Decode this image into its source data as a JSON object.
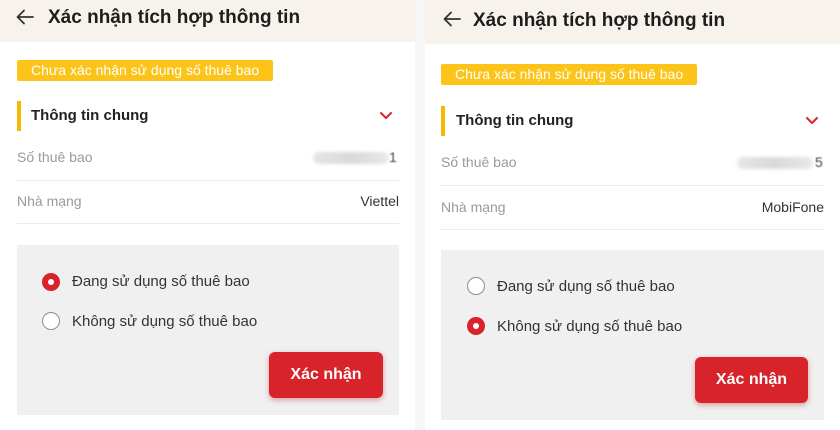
{
  "colors": {
    "accent": "#d8232a",
    "badge": "#fcc419",
    "section_bar": "#f5b800",
    "header_bg": "#f7f3ec",
    "option_box_bg": "#f0f0f0"
  },
  "icons": {
    "back": "arrow-left-icon",
    "expand": "chevron-down-icon"
  },
  "screens": [
    {
      "header": {
        "title": "Xác nhận tích hợp thông tin"
      },
      "status_badge": "Chưa xác nhận sử dụng số thuê bao",
      "section": {
        "title": "Thông tin chung",
        "expanded": true
      },
      "fields": [
        {
          "label": "Số thuê bao",
          "value_suffix": "1",
          "value_redacted": true
        },
        {
          "label": "Nhà mạng",
          "value": "Viettel"
        }
      ],
      "options": [
        {
          "label": "Đang sử dụng số thuê bao",
          "selected": true
        },
        {
          "label": "Không sử dụng số thuê bao",
          "selected": false
        }
      ],
      "confirm_label": "Xác nhận"
    },
    {
      "header": {
        "title": "Xác nhận tích hợp thông tin"
      },
      "status_badge": "Chưa xác nhận sử dụng số thuê bao",
      "section": {
        "title": "Thông tin chung",
        "expanded": true
      },
      "fields": [
        {
          "label": "Số thuê bao",
          "value_suffix": "5",
          "value_redacted": true
        },
        {
          "label": "Nhà mạng",
          "value": "MobiFone"
        }
      ],
      "options": [
        {
          "label": "Đang sử dụng số thuê bao",
          "selected": false
        },
        {
          "label": "Không sử dụng số thuê bao",
          "selected": true
        }
      ],
      "confirm_label": "Xác nhận"
    }
  ]
}
